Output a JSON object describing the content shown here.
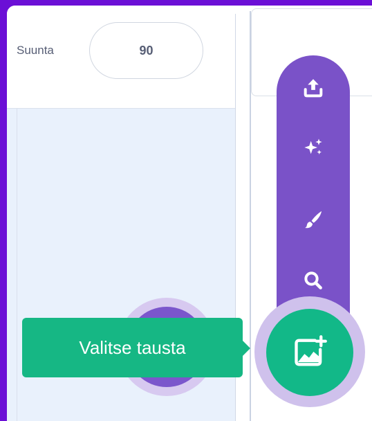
{
  "sprite_info": {
    "direction_label": "Suunta",
    "direction_value": "90"
  },
  "backdrop_menu": {
    "items": [
      {
        "icon": "upload-icon"
      },
      {
        "icon": "surprise-icon"
      },
      {
        "icon": "paint-icon"
      },
      {
        "icon": "search-icon"
      }
    ],
    "main_button_icon": "choose-backdrop-icon",
    "tooltip": "Valitse tausta"
  },
  "colors": {
    "frame_border": "#6b0fd6",
    "menu_purple": "#7a52c8",
    "accent_green": "#16b784",
    "stage_area": "#e9f1fc"
  }
}
